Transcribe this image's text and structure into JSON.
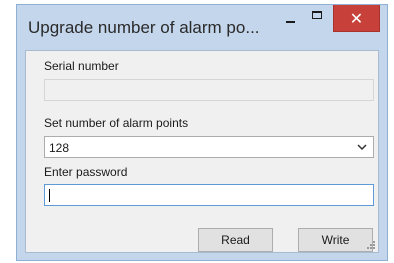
{
  "window": {
    "title": "Upgrade number of alarm po..."
  },
  "titlebar_buttons": {
    "minimize_icon": "minimize-icon",
    "maximize_icon": "maximize-icon",
    "close_icon": "close-icon",
    "close_glyph": "✕",
    "close_color": "#c7413a"
  },
  "form": {
    "serial_label": "Serial number",
    "serial_value": "",
    "alarm_points_label": "Set number of alarm points",
    "alarm_points_value": "128",
    "password_label": "Enter password",
    "password_value": ""
  },
  "buttons": {
    "read_label": "Read",
    "write_label": "Write"
  }
}
